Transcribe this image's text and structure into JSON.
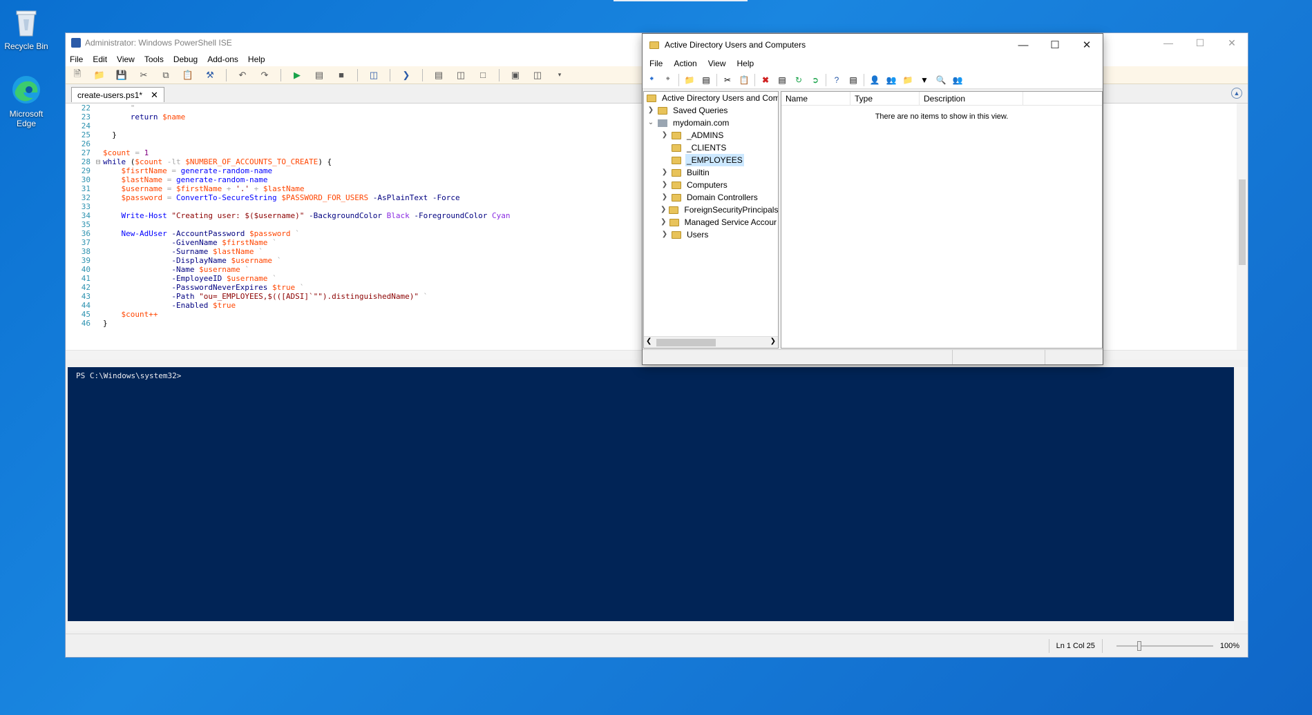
{
  "desktop": {
    "icons": [
      {
        "label": "Recycle Bin"
      },
      {
        "label": "Microsoft Edge"
      }
    ]
  },
  "ise": {
    "title": "Administrator: Windows PowerShell ISE",
    "menu": [
      "File",
      "Edit",
      "View",
      "Tools",
      "Debug",
      "Add-ons",
      "Help"
    ],
    "tab": {
      "label": "create-users.ps1*"
    },
    "console_prompt": "PS C:\\Windows\\system32>",
    "status": {
      "position": "Ln 1  Col 25",
      "zoom": "100%"
    },
    "code_lines": [
      {
        "n": "22"
      },
      {
        "n": "23"
      },
      {
        "n": "24"
      },
      {
        "n": "25"
      },
      {
        "n": "26"
      },
      {
        "n": "27"
      },
      {
        "n": "28"
      },
      {
        "n": "29"
      },
      {
        "n": "30"
      },
      {
        "n": "31"
      },
      {
        "n": "32"
      },
      {
        "n": "33"
      },
      {
        "n": "34"
      },
      {
        "n": "35"
      },
      {
        "n": "36"
      },
      {
        "n": "37"
      },
      {
        "n": "38"
      },
      {
        "n": "39"
      },
      {
        "n": "40"
      },
      {
        "n": "41"
      },
      {
        "n": "42"
      },
      {
        "n": "43"
      },
      {
        "n": "44"
      },
      {
        "n": "45"
      },
      {
        "n": "46"
      }
    ],
    "code_text": {
      "l23_return": "return",
      "l23_name": "$name",
      "l25": "}",
      "l27_count": "$count",
      "l27_eq": "=",
      "l27_one": "1",
      "l28_while": "while",
      "l28_open": "(",
      "l28_count": "$count",
      "l28_lt": "-lt",
      "l28_const": "$NUMBER_OF_ACCOUNTS_TO_CREATE",
      "l28_close": ") {",
      "l29_var": "$fisrtName",
      "l29_eq": "=",
      "l29_cmd": "generate-random-name",
      "l30_var": "$lastName",
      "l30_eq": "=",
      "l30_cmd": "generate-random-name",
      "l31_var": "$username",
      "l31_eq": "=",
      "l31_a": "$firstName",
      "l31_plus1": "+",
      "l31_dot": "'.'",
      "l31_plus2": "+",
      "l31_b": "$lastName",
      "l32_var": "$password",
      "l32_eq": "=",
      "l32_cmd": "ConvertTo-SecureString",
      "l32_arg": "$PASSWORD_FOR_USERS",
      "l32_p1": "-AsPlainText",
      "l32_p2": "-Force",
      "l34_cmd": "Write-Host",
      "l34_str": "\"Creating user: $($username)\"",
      "l34_p1": "-BackgroundColor",
      "l34_v1": "Black",
      "l34_p2": "-ForegroundColor",
      "l34_v2": "Cyan",
      "l36_cmd": "New-AdUser",
      "l36_p": "-AccountPassword",
      "l36_v": "$password",
      "l36_bt": "`",
      "l37_p": "-GivenName",
      "l37_v": "$firstName",
      "l37_bt": "`",
      "l38_p": "-Surname",
      "l38_v": "$lastName",
      "l38_bt": "`",
      "l39_p": "-DisplayName",
      "l39_v": "$username",
      "l39_bt": "`",
      "l40_p": "-Name",
      "l40_v": "$username",
      "l40_bt": "`",
      "l41_p": "-EmployeeID",
      "l41_v": "$username",
      "l41_bt": "`",
      "l42_p": "-PasswordNeverExpires",
      "l42_v": "$true",
      "l42_bt": "`",
      "l43_p": "-Path",
      "l43_s1": "\"ou=_EMPLOYEES,$(([ADSI]`\"\").distinguishedName)\"",
      "l43_bt": "`",
      "l44_p": "-Enabled",
      "l44_v": "$true",
      "l45": "$count++",
      "l46": "}"
    }
  },
  "aduc": {
    "title": "Active Directory Users and Computers",
    "menu": [
      "File",
      "Action",
      "View",
      "Help"
    ],
    "tree": [
      {
        "label": "Active Directory Users and Com"
      },
      {
        "label": "Saved Queries"
      },
      {
        "label": "mydomain.com"
      },
      {
        "label": "_ADMINS"
      },
      {
        "label": "_CLIENTS"
      },
      {
        "label": "_EMPLOYEES"
      },
      {
        "label": "Builtin"
      },
      {
        "label": "Computers"
      },
      {
        "label": "Domain Controllers"
      },
      {
        "label": "ForeignSecurityPrincipals"
      },
      {
        "label": "Managed Service Accour"
      },
      {
        "label": "Users"
      }
    ],
    "columns": [
      "Name",
      "Type",
      "Description"
    ],
    "empty_message": "There are no items to show in this view."
  },
  "colors": {
    "console_bg": "#012456",
    "selection": "#cce8ff",
    "toolbar_bg": "#fdf6e8"
  }
}
